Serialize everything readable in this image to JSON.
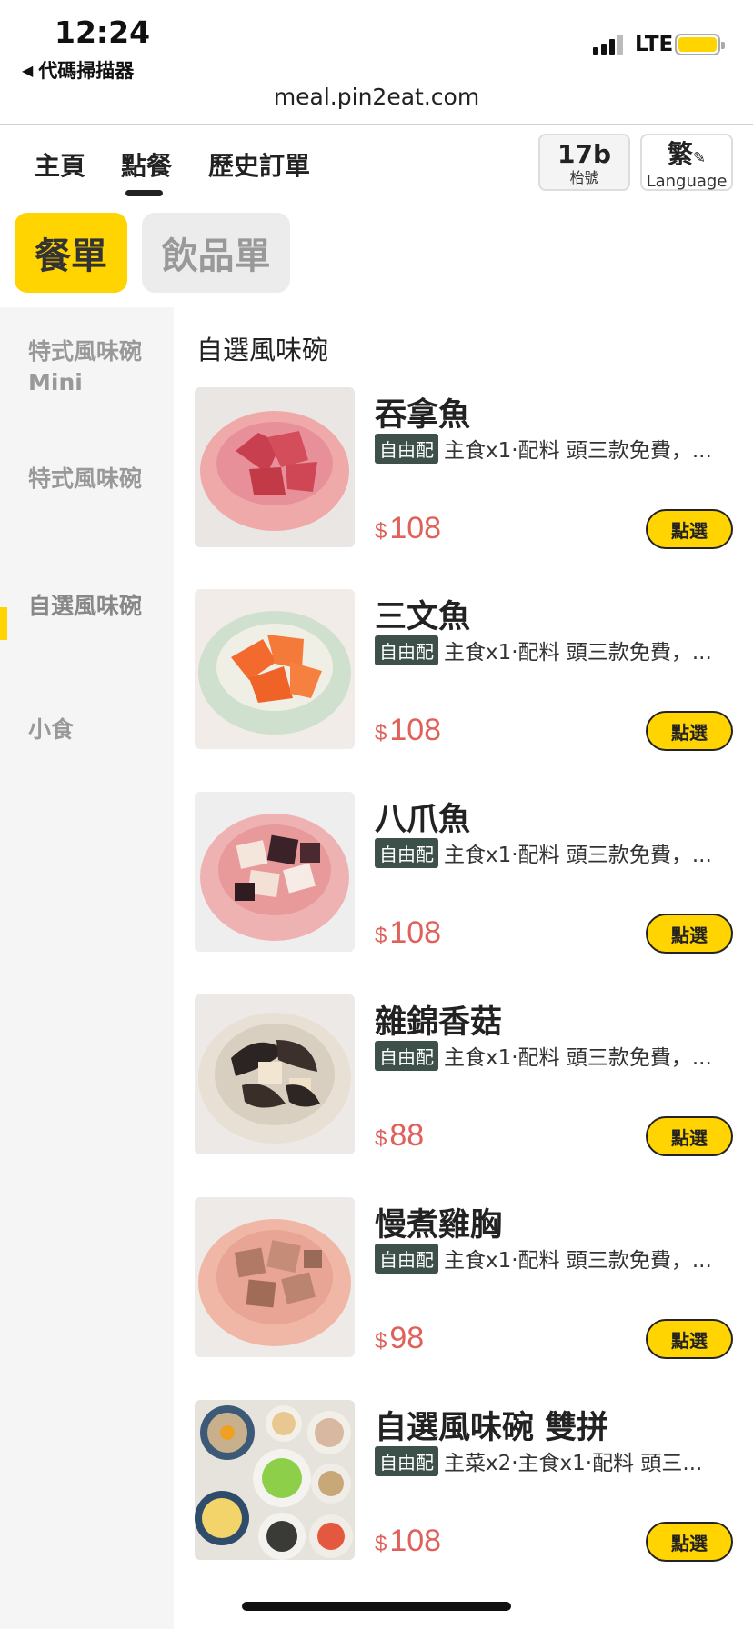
{
  "status_bar": {
    "time": "12:24",
    "back_app": "代碼掃描器",
    "network": "LTE",
    "battery_color": "#ffd400"
  },
  "browser": {
    "url": "meal.pin2eat.com"
  },
  "nav": {
    "tabs": [
      "主頁",
      "點餐",
      "歷史訂單"
    ],
    "active_tab": "點餐",
    "table_number": "17b",
    "table_label": "枱號",
    "language_current": "繁",
    "language_label": "Language",
    "pencil_icon": "✎"
  },
  "menu_types": {
    "food": "餐單",
    "drink": "飲品單",
    "active": "餐單",
    "accent_color": "#ffd400"
  },
  "sidebar": {
    "categories": [
      {
        "label": "特式風味碗 Mini"
      },
      {
        "label": "特式風味碗"
      },
      {
        "label": "自選風味碗",
        "active": true
      },
      {
        "label": "小食"
      }
    ]
  },
  "section": {
    "title": "自選風味碗"
  },
  "items": [
    {
      "name": "吞拿魚",
      "tag": "自由配",
      "desc": "主食x1‧配料 頭三款免費，...",
      "currency": "$",
      "price": "108",
      "button": "點選"
    },
    {
      "name": "三文魚",
      "tag": "自由配",
      "desc": "主食x1‧配料 頭三款免費，...",
      "currency": "$",
      "price": "108",
      "button": "點選"
    },
    {
      "name": "八爪魚",
      "tag": "自由配",
      "desc": "主食x1‧配料 頭三款免費，...",
      "currency": "$",
      "price": "108",
      "button": "點選"
    },
    {
      "name": "雜錦香菇",
      "tag": "自由配",
      "desc": "主食x1‧配料 頭三款免費，...",
      "currency": "$",
      "price": "88",
      "button": "點選"
    },
    {
      "name": "慢煮雞胸",
      "tag": "自由配",
      "desc": "主食x1‧配料 頭三款免費，...",
      "currency": "$",
      "price": "98",
      "button": "點選"
    },
    {
      "name": "自選風味碗 雙拼",
      "tag": "自由配",
      "desc": "主菜x2‧主食x1‧配料 頭三...",
      "currency": "$",
      "price": "108",
      "button": "點選"
    }
  ],
  "colors": {
    "price": "#e0605a",
    "tag_bg": "#3d5049"
  }
}
